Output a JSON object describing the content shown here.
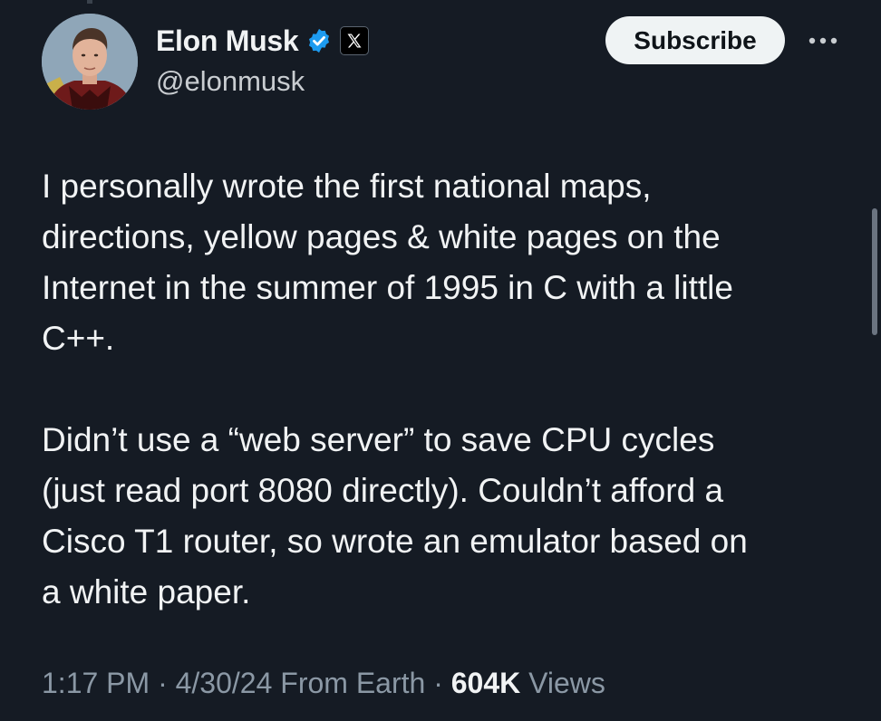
{
  "author": {
    "display_name": "Elon Musk",
    "handle": "@elonmusk",
    "avatar_icon": "person-avatar",
    "verified_icon": "verified-badge-icon",
    "affiliate_icon": "x-logo-icon"
  },
  "actions": {
    "subscribe_label": "Subscribe",
    "more_icon": "more-options-icon"
  },
  "tweet": {
    "paragraphs": [
      "I personally wrote the first national maps,\ndirections, yellow pages & white pages on the\nInternet in the summer of 1995 in C with a little\nC++.",
      "Didn’t use a “web server” to save CPU cycles\n(just read port 8080 directly). Couldn’t afford a\nCisco T1 router, so wrote an emulator based on\na white paper."
    ]
  },
  "meta": {
    "time": "1:17 PM",
    "separator": " · ",
    "date": "4/30/24",
    "source": "From Earth",
    "views_count": "604K",
    "views_label": "Views"
  },
  "colors": {
    "background": "#151b24",
    "verified_blue": "#1d9bf0",
    "secondary_text": "#8b98a5",
    "primary_text": "#f1f3f4"
  }
}
